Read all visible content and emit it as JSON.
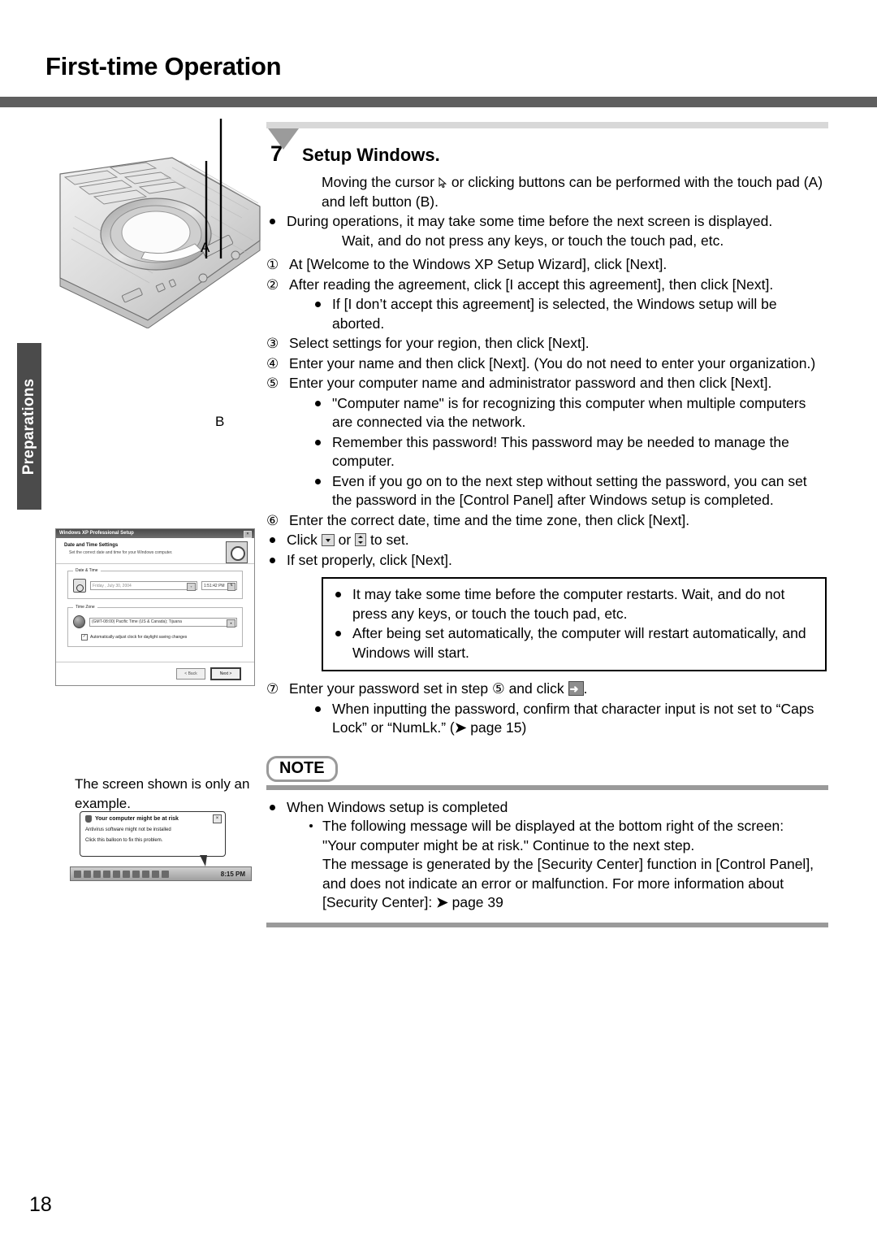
{
  "header": {
    "title": "First-time Operation"
  },
  "side_tab": {
    "label": "Preparations"
  },
  "figure": {
    "label_a": "A",
    "label_b": "B",
    "caption": "The screen shown is only an example."
  },
  "xp_dialog": {
    "title": "Windows XP Professional Setup",
    "close": "×",
    "head_title": "Date and Time Settings",
    "head_sub": "Set the correct date and time for your Windows computer.",
    "group_datetime_label": "Date & Time",
    "date_value": "Friday  ,  July    30, 2004",
    "time_value": "1:51:42 PM",
    "group_timezone_label": "Time Zone",
    "timezone_value": "(GMT-08:00) Pacific Time (US & Canada); Tijuana",
    "checkbox_mark": "✓",
    "checkbox_label": "Automatically adjust clock for daylight saving changes",
    "back_button": "< Back",
    "next_button": "Next >"
  },
  "balloon": {
    "title": "Your computer might be at risk",
    "close": "×",
    "line1": "Antivirus software might not be installed",
    "line2": "Click this balloon to fix this problem.",
    "tray_time": "8:15 PM"
  },
  "step": {
    "number": "7",
    "title": "Setup Windows.",
    "intro_before_cursor": "Moving the cursor",
    "intro_after_cursor": "or clicking buttons can be performed with the touch pad (A) and left button (B).",
    "bullet_during": "During operations, it may take some time before the next screen is displayed.",
    "bullet_wait": "Wait, and do not press any keys, or touch the touch pad, etc.",
    "items": [
      {
        "marker": "①",
        "text": "At [Welcome to the Windows XP Setup Wizard], click [Next]."
      },
      {
        "marker": "②",
        "text": "After reading the agreement, click [I accept this agreement], then click [Next].",
        "sub": [
          "If [I don’t accept this agreement] is selected, the Windows setup will be aborted."
        ]
      },
      {
        "marker": "③",
        "text": "Select settings for your region, then click [Next]."
      },
      {
        "marker": "④",
        "text": "Enter your name and then click [Next]. (You do not need to enter your organization.)"
      },
      {
        "marker": "⑤",
        "text": "Enter your computer name and administrator password and then click [Next].",
        "sub": [
          "\"Computer name\" is for recognizing this computer when multiple computers are connected via the network.",
          "Remember this password! This password may be needed to manage the computer.",
          "Even if you go on to the next step without setting the password, you can set the password in the [Control Panel] after Windows setup is completed."
        ]
      },
      {
        "marker": "⑥",
        "text": "Enter the correct date, time and the time zone, then click [Next]."
      }
    ],
    "click_prefix": "Click",
    "click_middle": "or",
    "click_suffix": "to set.",
    "if_set_properly": "If set properly, click [Next].",
    "caution": [
      "It may take some time before the computer restarts. Wait, and do not press any keys, or touch the touch pad, etc.",
      "After being set automatically, the computer will restart automatically, and Windows will start."
    ],
    "item7_marker": "⑦",
    "item7_before": "Enter your password set in step",
    "item7_step_ref": "⑤",
    "item7_middle": "and click",
    "item7_after": ".",
    "item7_sub_part1": "When inputting the password, confirm that character input is not set to “Caps Lock” or “NumLk.” (",
    "item7_sub_page": "page 15",
    "item7_sub_part2": ")"
  },
  "note": {
    "badge": "NOTE",
    "bullet": "When Windows setup is completed",
    "dash_line1": "The following message will be displayed at the bottom right of the screen:",
    "dash_line2": "\"Your computer might be at risk.\" Continue to the next step.",
    "cont_line1": "The message is generated by the [Security Center] function in [Control Panel],",
    "cont_line2": "and does not indicate an error or malfunction. For more information about",
    "cont_line3_before": "[Security Center]: ",
    "cont_line3_page": "page 39"
  },
  "footer": {
    "page_number": "18"
  },
  "colors": {
    "header_rule": "#5f5f5f",
    "side_tab": "#4b4b4b",
    "note_rule": "#9a9a9a",
    "top_bar": "#d8d8d8"
  }
}
